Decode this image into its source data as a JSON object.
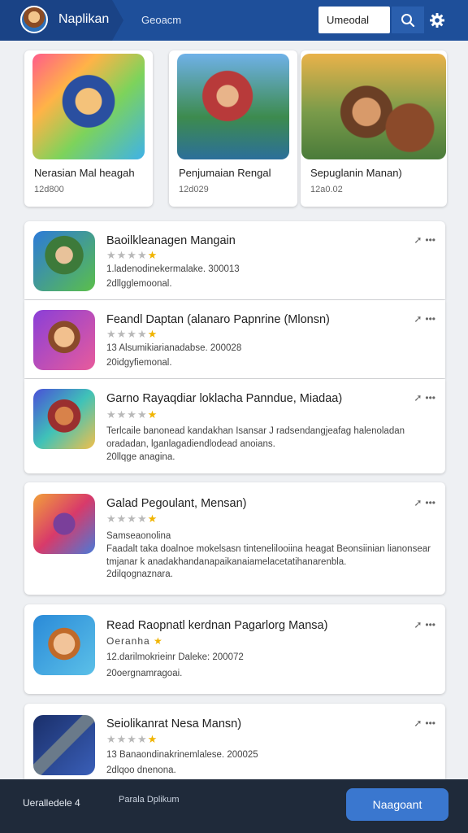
{
  "header": {
    "app_title": "Naplikan",
    "nav_link": "Geoacm",
    "search_value": "Umeodal"
  },
  "featured": [
    {
      "title": "Nerasian Mal heagah",
      "meta": "12d800"
    },
    {
      "title": "Penjumaian Rengal",
      "meta": "12d029"
    },
    {
      "title": "Sepuglanin Manan)",
      "meta": "12a0.02"
    }
  ],
  "apps": [
    {
      "name": "Baoilkleanagen Mangain",
      "desc": "",
      "meta1": "1.ladenodinekermalake. 300013",
      "meta2": "2dllgglemoonal.",
      "rating": 4
    },
    {
      "name": "Feandl Daptan (alanaro Papnrine (Mlonsn)",
      "desc": "",
      "meta1": "13 Alsumikiarianadabse. 200028",
      "meta2": "20idgyfiemonal.",
      "rating": 4
    },
    {
      "name": "Garno Rayaqdiar loklacha Panndue, Miadaa)",
      "desc": "Terlcaile banonead kandakhan Isansar J radsendangjeafag halenoladan oradadan, lganlagadiendlodead anoians.",
      "meta1": "",
      "meta2": "20llqge anagina.",
      "rating": 4
    },
    {
      "name": "Galad Pegoulant, Mensan)",
      "desc": "Samseaonolina\nFaadalt taka doalnoe mokelsasn tintenelilooiina heagat Beonsiinian lianonsear tmjanar k anadakhandanapaikanaiamelacetatihanarenbla.",
      "meta1": "",
      "meta2": "2dilqognaznara.",
      "rating": 4
    },
    {
      "name": "Read Raopnatl kerdnan Pagarlorg Mansa)",
      "desc": "Oeranha",
      "meta1": "12.darilmokrieinr Daleke: 200072",
      "meta2": "20oergnamragoai.",
      "rating": 1
    },
    {
      "name": "Seiolikanrat Nesa Mansn)",
      "desc": "",
      "meta1": "13 Banaondinakrinemlalese. 200025",
      "meta2": "2dlqoo dnenona.",
      "rating": 4
    }
  ],
  "bottom_bar": {
    "link1": "Ueralledele 4",
    "link2": "Parala Dplikum",
    "primary_button": "Naagoant"
  },
  "colors": {
    "header": "#1e4f9a",
    "accent": "#3a77cf",
    "bottom_bar": "#1f2a3a",
    "star": "#f0b400"
  },
  "icons": [
    "search-icon",
    "gear-icon",
    "pin-icon",
    "more-icon"
  ]
}
